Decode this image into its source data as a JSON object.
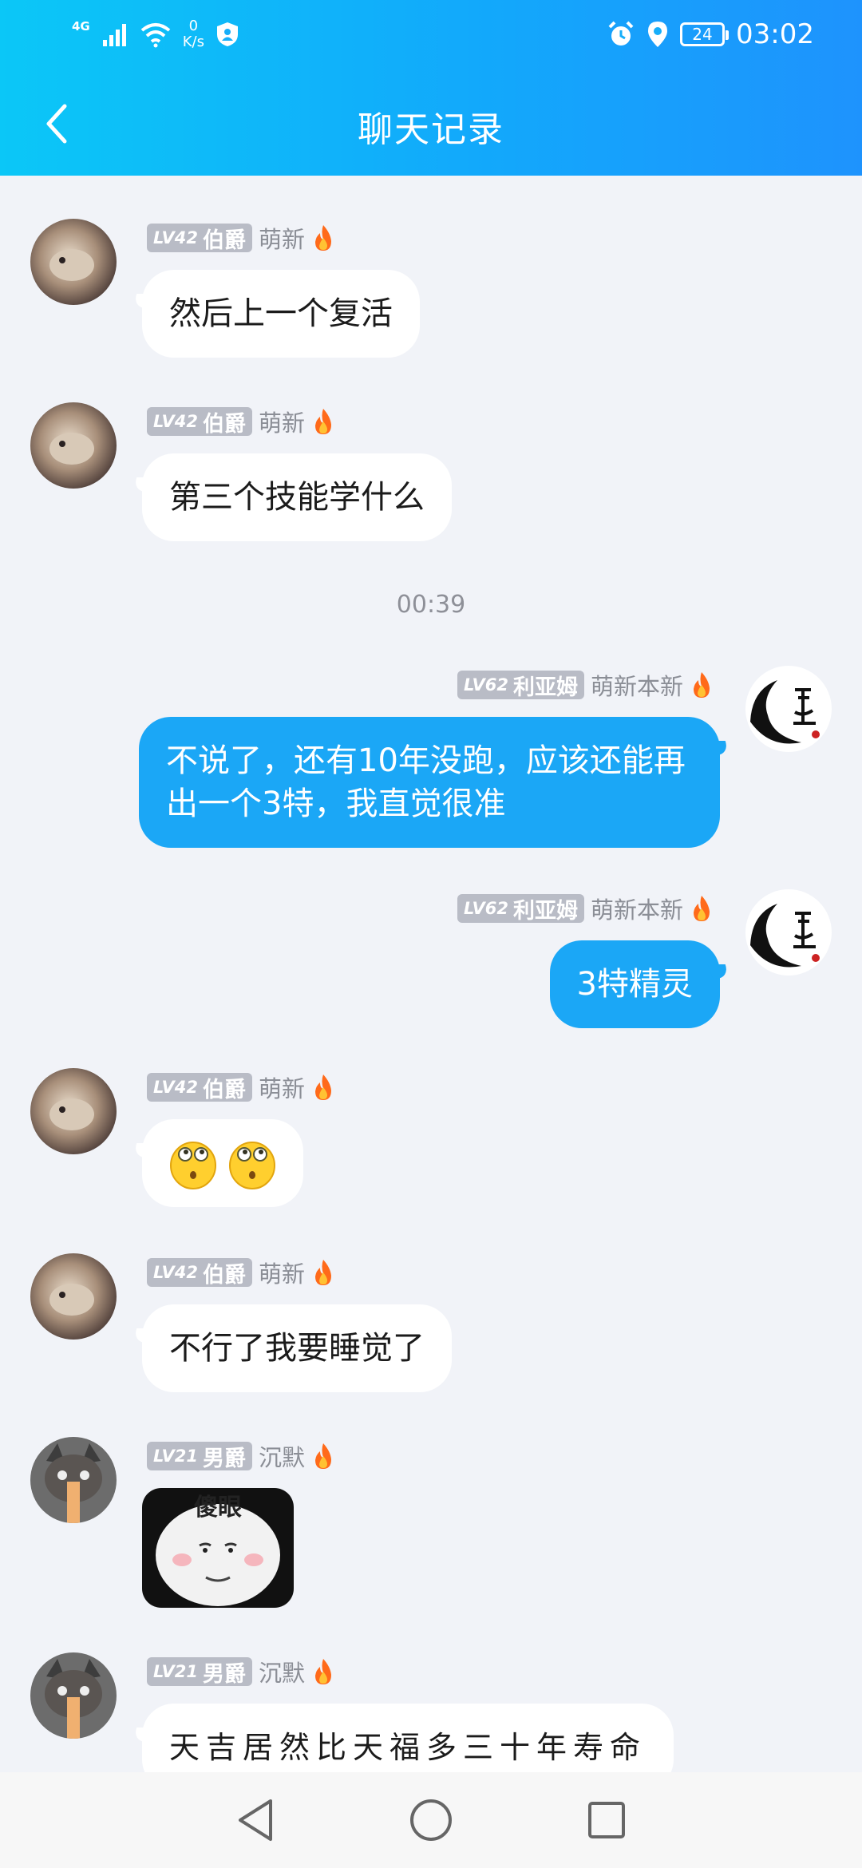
{
  "status_bar": {
    "network_generation": "4G",
    "net_speed_value": "0",
    "net_speed_unit": "K/s",
    "battery_level": "24",
    "time": "03:02"
  },
  "header": {
    "title": "聊天记录",
    "back_icon": "chevron-left-icon"
  },
  "colors": {
    "header_gradient_start": "#0bc7f7",
    "header_gradient_end": "#1e93fd",
    "outgoing_bubble": "#1ba7f6",
    "incoming_bubble": "#ffffff",
    "badge_bg": "#b9bcc6",
    "background": "#f1f3f8"
  },
  "messages": [
    {
      "side": "left",
      "level": "LV42",
      "rank": "伯爵",
      "tag": "萌新",
      "text": "然后上一个复活"
    },
    {
      "side": "left",
      "level": "LV42",
      "rank": "伯爵",
      "tag": "萌新",
      "text": "第三个技能学什么"
    },
    {
      "timestamp": "00:39"
    },
    {
      "side": "right",
      "level": "LV62",
      "rank": "利亚姆",
      "tag": "萌新本新",
      "text": "不说了，还有10年没跑，应该还能再出一个3特，我直觉很准"
    },
    {
      "side": "right",
      "level": "LV62",
      "rank": "利亚姆",
      "tag": "萌新本新",
      "text": "3特精灵"
    },
    {
      "side": "left",
      "level": "LV42",
      "rank": "伯爵",
      "tag": "萌新",
      "emoji": [
        "thinking-face-emoji",
        "thinking-face-emoji"
      ]
    },
    {
      "side": "left",
      "level": "LV42",
      "rank": "伯爵",
      "tag": "萌新",
      "text": "不行了我要睡觉了"
    },
    {
      "side": "left",
      "level": "LV21",
      "rank": "男爵",
      "tag": "沉默",
      "sticker_text": "傻眼"
    },
    {
      "side": "left",
      "level": "LV21",
      "rank": "男爵",
      "tag": "沉默",
      "text": "天吉居然比天福多三十年寿命"
    }
  ],
  "navbar": {
    "back": "triangle-back-icon",
    "home": "circle-home-icon",
    "recent": "square-recents-icon"
  }
}
